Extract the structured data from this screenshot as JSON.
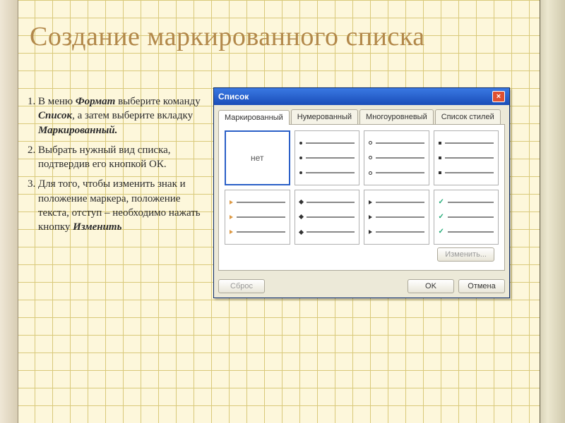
{
  "title": "Создание маркированного списка",
  "steps": [
    {
      "pre": "В меню ",
      "em1": "Формат",
      "mid": " выберите команду ",
      "em2": "Список",
      "mid2": ", а затем выберите вкладку ",
      "em3": "Маркированный.",
      "post": ""
    },
    {
      "pre": "Выбрать нужный вид списка, подтвердив его кнопкой ОК.",
      "em1": "",
      "mid": "",
      "em2": "",
      "mid2": "",
      "em3": "",
      "post": ""
    },
    {
      "pre": "Для того, чтобы изменить знак и положение маркера, положение текста, отступ – необходимо нажать кнопку ",
      "em1": "Изменить",
      "mid": "",
      "em2": "",
      "mid2": "",
      "em3": "",
      "post": ""
    }
  ],
  "dialog": {
    "title": "Список",
    "close_label": "×",
    "tabs": [
      "Маркированный",
      "Нумерованный",
      "Многоуровневый",
      "Список стилей"
    ],
    "none_label": "нет",
    "modify_label": "Изменить...",
    "reset_label": "Сброс",
    "ok_label": "OK",
    "cancel_label": "Отмена"
  }
}
